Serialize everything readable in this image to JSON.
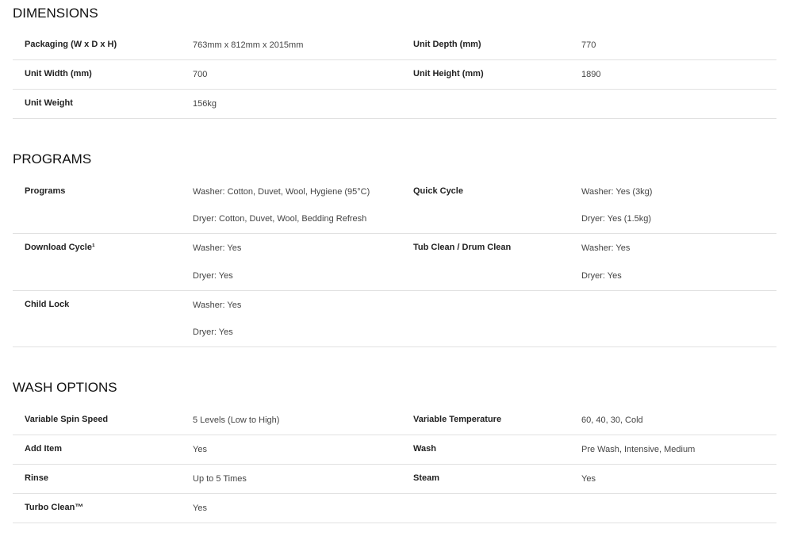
{
  "dimensions": {
    "title": "DIMENSIONS",
    "rows": [
      {
        "label1": "Packaging (W x D x H)",
        "value1": "763mm x 812mm x 2015mm",
        "label2": "Unit Depth (mm)",
        "value2": "770"
      },
      {
        "label1": "Unit Width (mm)",
        "value1": "700",
        "label2": "Unit Height (mm)",
        "value2": "1890"
      },
      {
        "label1": "Unit Weight",
        "value1": "156kg"
      }
    ]
  },
  "programs": {
    "title": "PROGRAMS",
    "rows": [
      {
        "label1": "Programs",
        "value1a": "Washer: Cotton, Duvet, Wool, Hygiene (95°C)",
        "value1b": "Dryer: Cotton, Duvet, Wool, Bedding Refresh",
        "label2": "Quick Cycle",
        "value2a": "Washer: Yes (3kg)",
        "value2b": "Dryer: Yes (1.5kg)"
      },
      {
        "label1": "Download Cycle¹",
        "value1a": "Washer: Yes",
        "value1b": "Dryer: Yes",
        "label2": "Tub Clean / Drum Clean",
        "value2a": "Washer: Yes",
        "value2b": "Dryer: Yes"
      },
      {
        "label1": "Child Lock",
        "value1a": "Washer: Yes",
        "value1b": "Dryer: Yes"
      }
    ]
  },
  "wash_options": {
    "title": "WASH OPTIONS",
    "rows": [
      {
        "label1": "Variable Spin Speed",
        "value1": "5 Levels (Low to High)",
        "label2": "Variable Temperature",
        "value2": "60, 40, 30, Cold"
      },
      {
        "label1": "Add Item",
        "value1": "Yes",
        "label2": "Wash",
        "value2": "Pre Wash, Intensive, Medium"
      },
      {
        "label1": "Rinse",
        "value1": "Up to 5 Times",
        "label2": "Steam",
        "value2": "Yes"
      },
      {
        "label1": "Turbo Clean™",
        "value1": "Yes"
      }
    ]
  }
}
